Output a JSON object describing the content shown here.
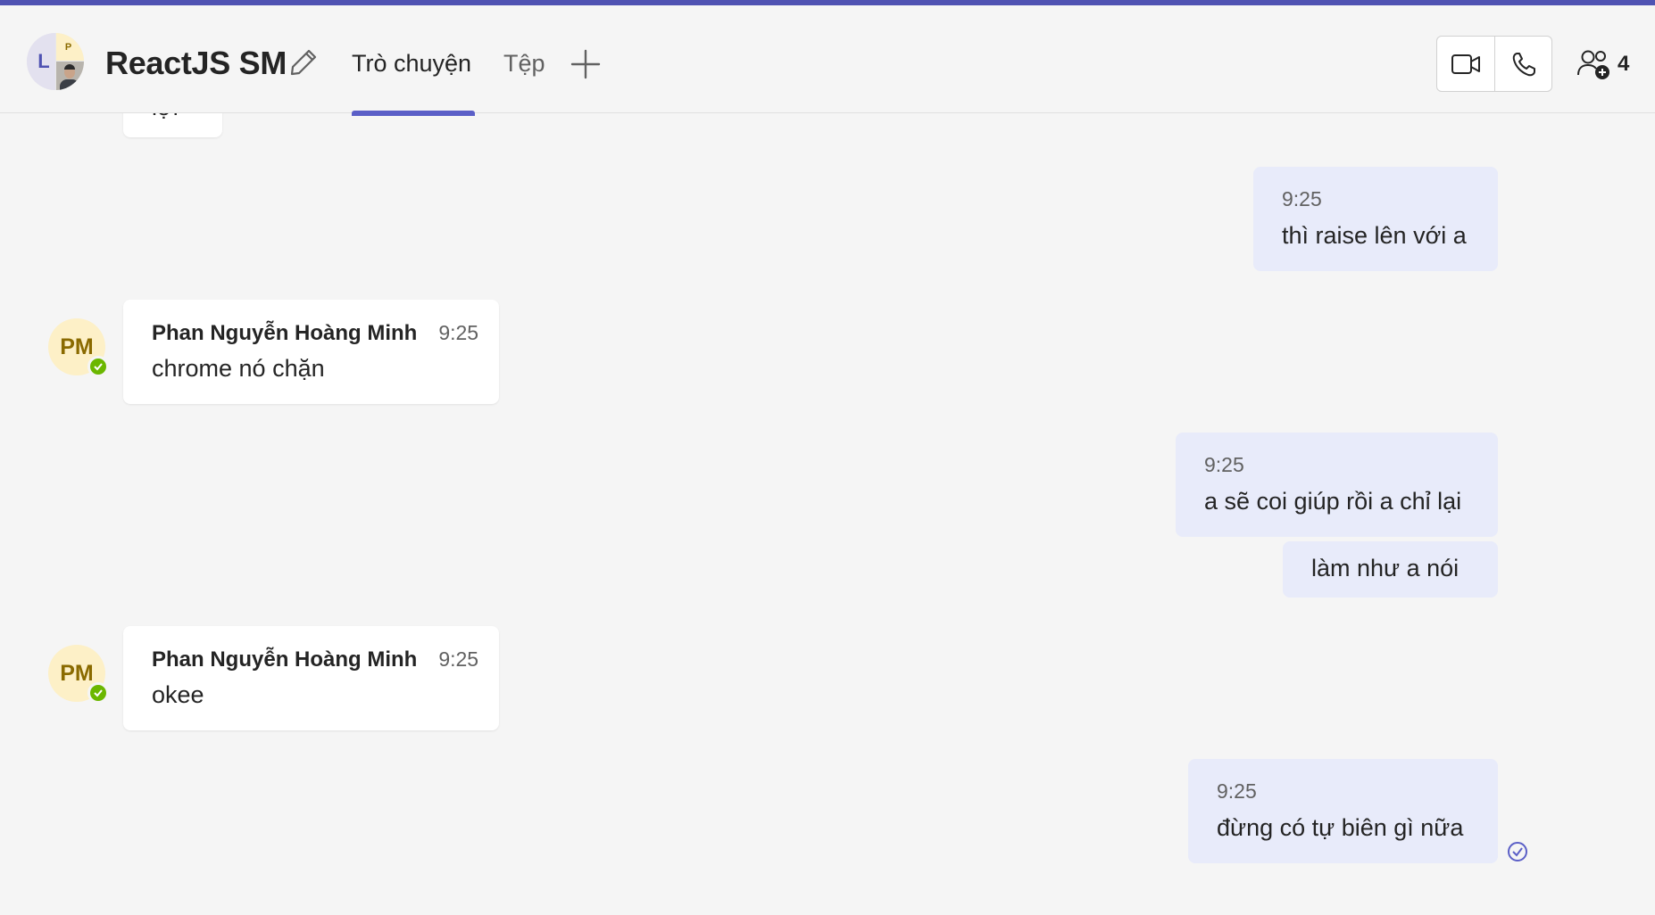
{
  "header": {
    "title": "ReactJS SM",
    "group_avatar_initials": {
      "left": "L",
      "top_right": "P"
    },
    "tabs": [
      {
        "label": "Trò chuyện",
        "active": true
      },
      {
        "label": "Tệp",
        "active": false
      }
    ],
    "participant_count": "4",
    "icons": [
      "edit-icon",
      "add-tab-icon",
      "video-call-icon",
      "audio-call-icon",
      "add-people-icon"
    ]
  },
  "messages": [
    {
      "direction": "in",
      "text": "lợi"
    },
    {
      "direction": "out",
      "time": "9:25",
      "text": "thì raise lên với a"
    },
    {
      "direction": "in",
      "author": "Phan Nguyễn Hoàng Minh",
      "initials": "PM",
      "time": "9:25",
      "text": "chrome nó chặn"
    },
    {
      "direction": "out",
      "time": "9:25",
      "text": "a sẽ coi giúp rồi a chỉ lại"
    },
    {
      "direction": "out",
      "text": "làm như a nói"
    },
    {
      "direction": "in",
      "author": "Phan Nguyễn Hoàng Minh",
      "initials": "PM",
      "time": "9:25",
      "text": "okee"
    },
    {
      "direction": "out",
      "time": "9:25",
      "text": "đừng có tự biên gì nữa",
      "status": "sent"
    }
  ],
  "colors": {
    "accent": "#4f52b2",
    "tab_underline": "#5b5fc7",
    "outgoing_bubble": "#e8ebfa",
    "incoming_bubble": "#ffffff",
    "presence_available": "#6bb700",
    "avatar_bg": "#fdf0c7"
  }
}
